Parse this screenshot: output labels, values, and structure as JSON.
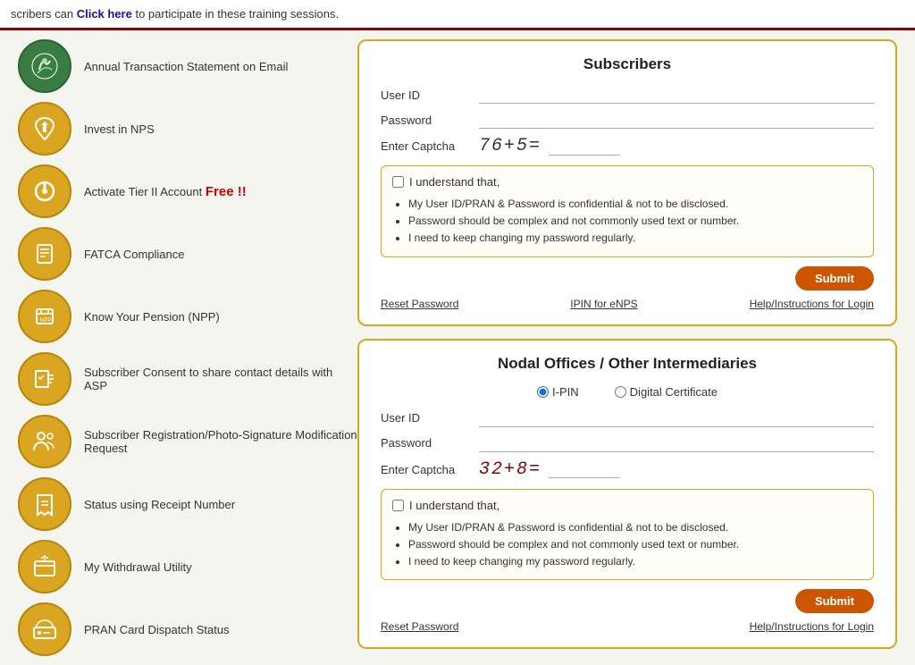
{
  "banner": {
    "text_before_link": "scribers can ",
    "link_text": "Click here",
    "text_after_link": " to participate in these training sessions."
  },
  "menu": {
    "items": [
      {
        "id": "annual-statement",
        "label": "Annual Transaction Statement on Email",
        "icon_type": "green",
        "icon": "leaf"
      },
      {
        "id": "invest-nps",
        "label": "Invest in NPS",
        "icon_type": "gold",
        "icon": "hands"
      },
      {
        "id": "activate-tier2",
        "label": "Activate Tier II Account",
        "free_text": "Free !!",
        "icon_type": "gold",
        "icon": "power"
      },
      {
        "id": "fatca",
        "label": "FATCA Compliance",
        "icon_type": "gold",
        "icon": "briefcase"
      },
      {
        "id": "know-pension",
        "label": "Know Your Pension (NPP)",
        "icon_type": "gold",
        "icon": "calculator"
      },
      {
        "id": "subscriber-consent",
        "label": "Subscriber Consent to share contact details with ASP",
        "icon_type": "gold",
        "icon": "form"
      },
      {
        "id": "subscriber-registration",
        "label": "Subscriber Registration/Photo-Signature Modification Request",
        "icon_type": "gold",
        "icon": "people"
      },
      {
        "id": "status-receipt",
        "label": "Status using Receipt Number",
        "icon_type": "gold",
        "icon": "receipt"
      },
      {
        "id": "withdrawal",
        "label": "My Withdrawal Utility",
        "icon_type": "gold",
        "icon": "envelope"
      },
      {
        "id": "pran-card",
        "label": "PRAN Card Dispatch Status",
        "icon_type": "gold",
        "icon": "truck"
      }
    ]
  },
  "subscribers_panel": {
    "title": "Subscribers",
    "user_id_label": "User ID",
    "password_label": "Password",
    "captcha_label": "Enter Captcha",
    "captcha_display": "76+5=",
    "understand_label": "I understand that,",
    "bullets": [
      "My User ID/PRAN & Password is confidential & not to be disclosed.",
      "Password should be complex and not commonly used text or number.",
      "I need to keep changing my password regularly."
    ],
    "submit_label": "Submit",
    "reset_password_label": "Reset Password",
    "ipin_label": "IPIN for eNPS",
    "help_label": "Help/Instructions for Login"
  },
  "nodal_panel": {
    "title": "Nodal Offices / Other Intermediaries",
    "ipin_label": "I-PIN",
    "digital_label": "Digital Certificate",
    "user_id_label": "User ID",
    "password_label": "Password",
    "captcha_label": "Enter Captcha",
    "captcha_display": "32+8=",
    "understand_label": "I understand that,",
    "bullets": [
      "My User ID/PRAN & Password is confidential & not to be disclosed.",
      "Password should be complex and not commonly used text or number.",
      "I need to keep changing my password regularly."
    ],
    "submit_label": "Submit",
    "reset_password_label": "Reset Password",
    "help_label": "Help/Instructions for Login"
  }
}
